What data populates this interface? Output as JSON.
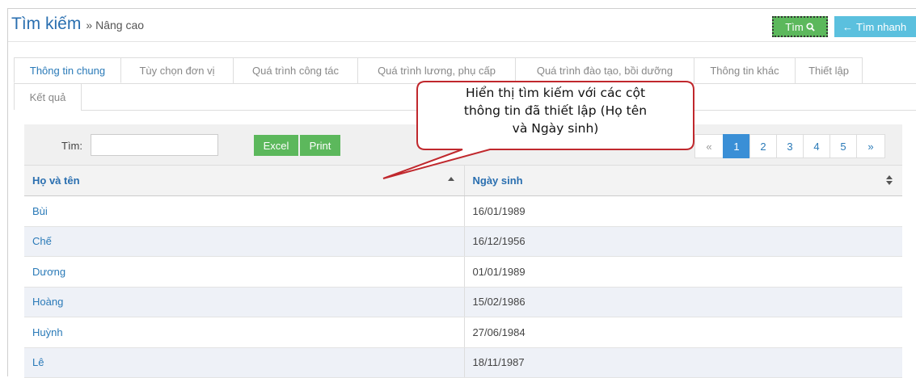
{
  "header": {
    "title": "Tìm kiếm",
    "separator": "»",
    "subtitle": "Nâng cao",
    "search_button": "Tìm",
    "search_icon": "search-icon",
    "quick_button": "Tìm nhanh",
    "quick_arrow": "←"
  },
  "tabs": [
    {
      "label": "Thông tin chung",
      "active": true
    },
    {
      "label": "Tùy chọn đơn vị",
      "active": false
    },
    {
      "label": "Quá trình công tác",
      "active": false
    },
    {
      "label": "Quá trình lương, phụ cấp",
      "active": false
    },
    {
      "label": "Quá trình đào tạo, bồi dưỡng",
      "active": false
    },
    {
      "label": "Thông tin khác",
      "active": false
    },
    {
      "label": "Thiết lập",
      "active": false
    },
    {
      "label": "Kết quả",
      "active": false
    }
  ],
  "toolbar": {
    "search_label": "Tìm:",
    "search_value": "",
    "excel_label": "Excel",
    "print_label": "Print"
  },
  "pagination": {
    "prev": "«",
    "pages": [
      "1",
      "2",
      "3",
      "4",
      "5"
    ],
    "current": "1",
    "next": "»"
  },
  "table": {
    "columns": [
      "Họ và tên",
      "Ngày sinh"
    ],
    "rows": [
      [
        "Bùi",
        "16/01/1989"
      ],
      [
        "Chế",
        "16/12/1956"
      ],
      [
        "Dương",
        "01/01/1989"
      ],
      [
        "Hoàng",
        "15/02/1986"
      ],
      [
        "Huỳnh",
        "27/06/1984"
      ],
      [
        "Lê",
        "18/11/1987"
      ]
    ]
  },
  "callout": {
    "line1": "Hiển thị tìm kiếm với các cột",
    "line2": "thông tin đã thiết lập (Họ tên",
    "line3": "và Ngày sinh)",
    "border_color": "#c0282d"
  },
  "colors": {
    "title": "#2a6fb0",
    "link": "#2a7ab8",
    "success": "#5cb85c",
    "info": "#5bc0de",
    "page_active": "#3a8fd6"
  }
}
